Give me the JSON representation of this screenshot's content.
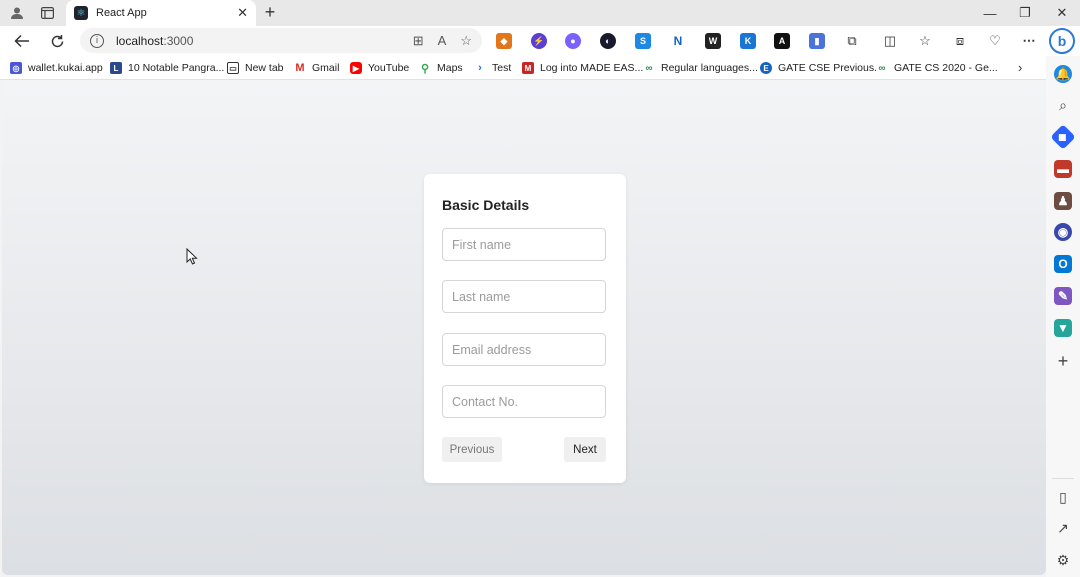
{
  "browser": {
    "tab": {
      "title": "React App",
      "favicon": "react-icon",
      "close_icon": "✕"
    },
    "new_tab_icon": "+",
    "window_controls": {
      "minimize": "—",
      "restore": "❐",
      "close": "✕"
    },
    "address": {
      "host": "localhost",
      "port": ":3000"
    },
    "bing_label": "b"
  },
  "bookmarks": [
    {
      "label": "wallet.kukai.app",
      "icon": "kukai-icon",
      "color": "#4a56d6"
    },
    {
      "label": "10 Notable Pangra...",
      "icon": "page-icon",
      "color": "#2b4a8b"
    },
    {
      "label": "New tab",
      "icon": "newtab-icon",
      "color": "#333333"
    },
    {
      "label": "Gmail",
      "icon": "gmail-icon",
      "color": "#d93025"
    },
    {
      "label": "YouTube",
      "icon": "youtube-icon",
      "color": "#ff0000"
    },
    {
      "label": "Maps",
      "icon": "maps-icon",
      "color": "#34a853"
    },
    {
      "label": "Test",
      "icon": "test-icon",
      "color": "#1a73e8"
    },
    {
      "label": "Log into MADE EAS...",
      "icon": "made-easy-icon",
      "color": "#c62828"
    },
    {
      "label": "Regular languages...",
      "icon": "geeks-icon",
      "color": "#2f8d46"
    },
    {
      "label": "GATE CSE Previous...",
      "icon": "gate-icon",
      "color": "#1565c0"
    },
    {
      "label": "GATE CS 2020 - Ge...",
      "icon": "geeks-icon",
      "color": "#2f8d46"
    }
  ],
  "form": {
    "title": "Basic Details",
    "fields": {
      "first_name": {
        "placeholder": "First name",
        "value": ""
      },
      "last_name": {
        "placeholder": "Last name",
        "value": ""
      },
      "email": {
        "placeholder": "Email address",
        "value": ""
      },
      "contact": {
        "placeholder": "Contact No.",
        "value": ""
      }
    },
    "previous_label": "Previous",
    "next_label": "Next"
  }
}
